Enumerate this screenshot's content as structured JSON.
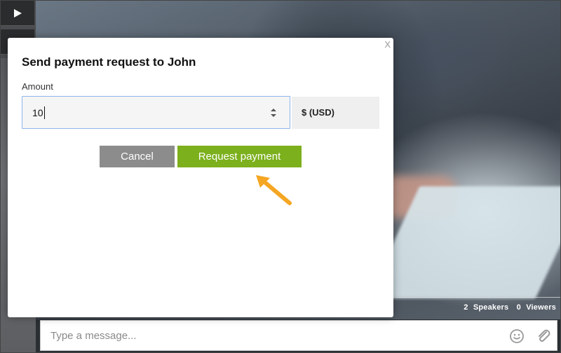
{
  "sidebar": {
    "play_icon": "play-icon",
    "second_icon": "indicator-icon"
  },
  "modal": {
    "title": "Send payment request to John",
    "close_label": "X",
    "amount_label": "Amount",
    "amount_value": "10",
    "currency_label": "$ (USD)",
    "cancel_label": "Cancel",
    "request_label": "Request payment"
  },
  "status": {
    "speakers_count": "2",
    "speakers_label": "Speakers",
    "viewers_count": "0",
    "viewers_label": "Viewers"
  },
  "message": {
    "placeholder": "Type a message..."
  },
  "colors": {
    "request_button": "#7cb01c",
    "cancel_button": "#8c8c8c",
    "annotation_arrow": "#f5a623"
  }
}
